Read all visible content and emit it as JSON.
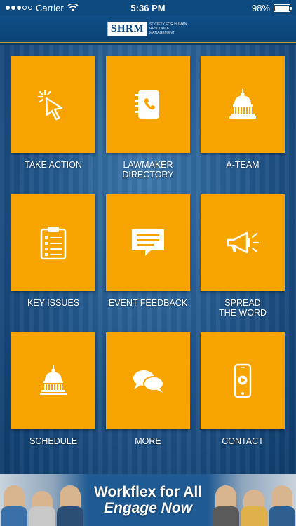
{
  "status_bar": {
    "carrier": "Carrier",
    "time": "5:36 PM",
    "battery": "98%",
    "battery_level": 0.98,
    "signal_bars_on": 3,
    "signal_bars_total": 5
  },
  "header": {
    "logo_mark": "SHRM",
    "logo_subtitle": "Society for Human Resource Management"
  },
  "tiles": [
    {
      "label": "TAKE ACTION",
      "icon": "pointer-click-icon"
    },
    {
      "label": "LAWMAKER\nDIRECTORY",
      "icon": "phone-book-icon"
    },
    {
      "label": "A-TEAM",
      "icon": "capitol-dome-icon"
    },
    {
      "label": "KEY ISSUES",
      "icon": "clipboard-list-icon"
    },
    {
      "label": "EVENT FEEDBACK",
      "icon": "speech-bubble-icon"
    },
    {
      "label": "SPREAD\nTHE WORD",
      "icon": "megaphone-icon"
    },
    {
      "label": "SCHEDULE",
      "icon": "capitol-dome-icon"
    },
    {
      "label": "MORE",
      "icon": "chat-bubbles-icon"
    },
    {
      "label": "CONTACT",
      "icon": "smartphone-video-icon"
    }
  ],
  "banner": {
    "title": "Workflex for All",
    "subtitle": "Engage Now"
  },
  "colors": {
    "tile": "#f7a300",
    "header": "#0b4275",
    "accent_line": "#c99a2e"
  }
}
